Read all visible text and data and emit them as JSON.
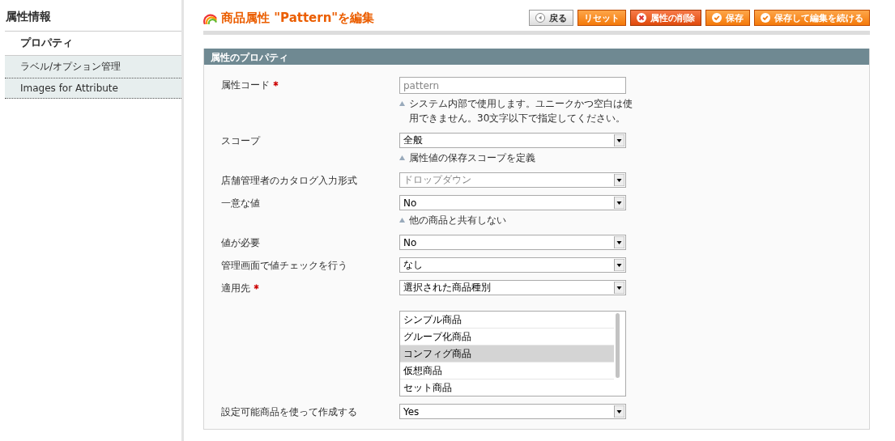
{
  "sidebar": {
    "title": "属性情報",
    "items": [
      {
        "label": "プロパティ",
        "selected": true
      },
      {
        "label": "ラベル/オプション管理",
        "selected": false
      },
      {
        "label": "Images for Attribute",
        "selected": false
      }
    ]
  },
  "header": {
    "title": "商品属性 \"Pattern\"を編集",
    "buttons": [
      {
        "label": "戻る",
        "kind": "back"
      },
      {
        "label": "リセット",
        "kind": "plain"
      },
      {
        "label": "属性の削除",
        "kind": "delete"
      },
      {
        "label": "保存",
        "kind": "save"
      },
      {
        "label": "保存して編集を続ける",
        "kind": "save"
      }
    ]
  },
  "panel": {
    "title": "属性のプロパティ",
    "fields": [
      {
        "label": "属性コード",
        "required": true,
        "kind": "text",
        "value": "pattern",
        "disabled": true,
        "hint": "システム内部で使用します。ユニークかつ空白は使用できません。30文字以下で指定してください。"
      },
      {
        "label": "スコープ",
        "required": false,
        "kind": "select",
        "value": "全般",
        "disabled": false,
        "hint": "属性値の保存スコープを定義"
      },
      {
        "label": "店舗管理者のカタログ入力形式",
        "required": false,
        "kind": "select",
        "value": "ドロップダウン",
        "disabled": true
      },
      {
        "label": "一意な値",
        "required": false,
        "kind": "select",
        "value": "No",
        "disabled": false,
        "hint": "他の商品と共有しない"
      },
      {
        "label": "値が必要",
        "required": false,
        "kind": "select",
        "value": "No",
        "disabled": false
      },
      {
        "label": "管理画面で値チェックを行う",
        "required": false,
        "kind": "select",
        "value": "なし",
        "disabled": false
      },
      {
        "label": "適用先",
        "required": true,
        "kind": "select",
        "value": "選択された商品種別",
        "disabled": false
      },
      {
        "kind": "multiselect",
        "options": [
          {
            "label": "シンプル商品",
            "selected": false
          },
          {
            "label": "グループ化商品",
            "selected": false
          },
          {
            "label": "コンフィグ商品",
            "selected": true
          },
          {
            "label": "仮想商品",
            "selected": false
          },
          {
            "label": "セット商品",
            "selected": false
          }
        ]
      },
      {
        "label": "設定可能商品を使って作成する",
        "required": false,
        "kind": "select",
        "value": "Yes",
        "disabled": false
      }
    ]
  }
}
